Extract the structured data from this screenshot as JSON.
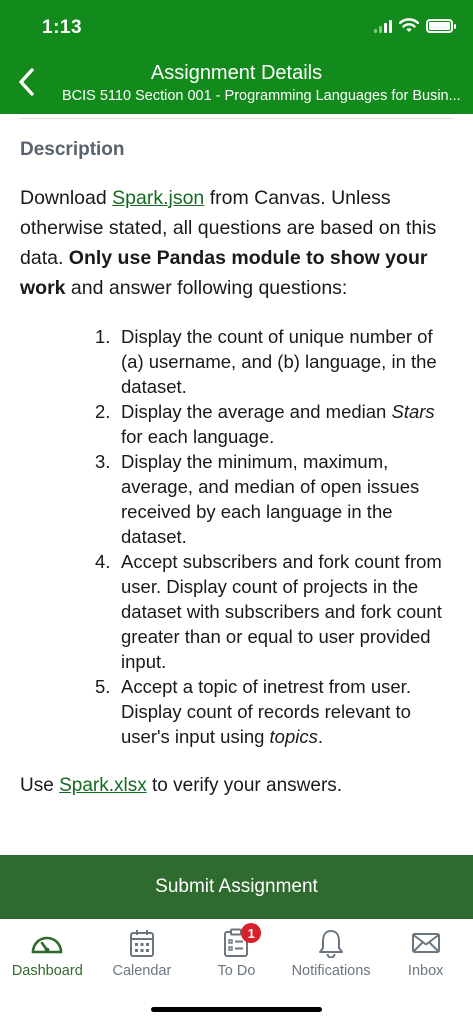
{
  "status_bar": {
    "time": "1:13"
  },
  "header": {
    "title": "Assignment Details",
    "subtitle": "BCIS 5110 Section 001 - Programming Languages for Busin..."
  },
  "description": {
    "heading": "Description",
    "intro_pre": "Download ",
    "intro_link": "Spark.json",
    "intro_mid": " from Canvas. Unless otherwise stated, all questions are based on this data. ",
    "intro_bold": "Only use Pandas module to show your work",
    "intro_post": " and answer following questions:",
    "questions": [
      {
        "num": "1.",
        "text": "Display the count of unique number of (a) username, and (b) language, in the dataset."
      },
      {
        "num": "2.",
        "text_pre": "Display the average and median ",
        "text_italic": "Stars",
        "text_post": " for each language."
      },
      {
        "num": "3.",
        "text": "Display the minimum, maximum, average, and median of open issues received by each language in the dataset."
      },
      {
        "num": "4.",
        "text": "Accept subscribers and fork count from user. Display count of projects in the dataset with subscribers and fork count greater than or equal to user provided input."
      },
      {
        "num": "5.",
        "text_pre": "Accept a topic of inetrest from user. Display count of records relevant to user's input using ",
        "text_italic": "topics",
        "text_post": "."
      }
    ],
    "outro_pre": "Use ",
    "outro_link": "Spark.xlsx",
    "outro_post": " to verify your answers."
  },
  "submit_label": "Submit Assignment",
  "tabs": [
    {
      "label": "Dashboard",
      "icon": "dashboard-gauge-icon"
    },
    {
      "label": "Calendar",
      "icon": "calendar-icon"
    },
    {
      "label": "To Do",
      "icon": "clipboard-icon",
      "badge": "1"
    },
    {
      "label": "Notifications",
      "icon": "bell-icon"
    },
    {
      "label": "Inbox",
      "icon": "envelope-icon"
    }
  ],
  "colors": {
    "header": "#138a1c",
    "submit": "#2f6b2e",
    "link": "#146b1f",
    "badge": "#d8202a"
  }
}
